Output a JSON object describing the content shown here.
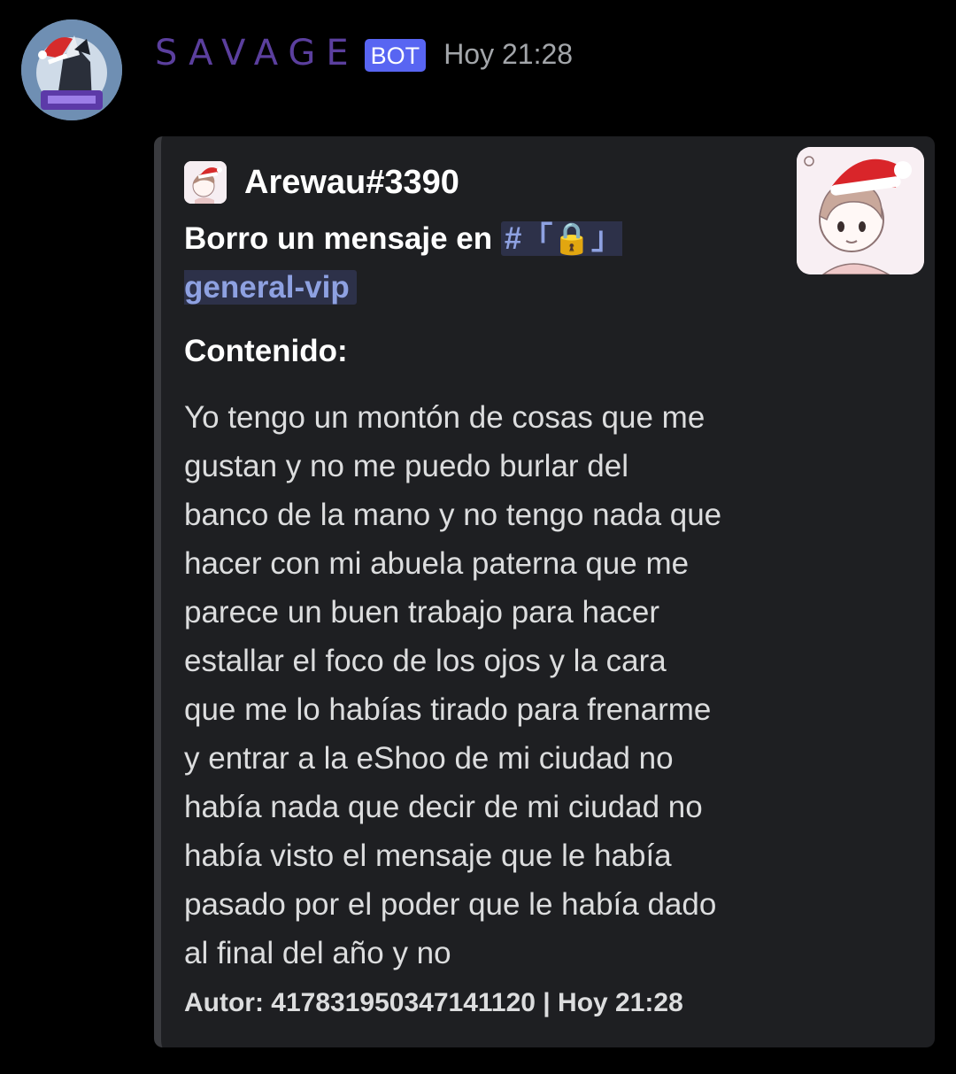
{
  "message": {
    "author": "SAVAGE",
    "badge": "BOT",
    "timestamp": "Hoy 21:28",
    "avatar_icon": "wolf-santa-hat-avatar",
    "colors": {
      "author": "#5b3f9e",
      "badge_bg": "#5865f2",
      "embed_bg": "#1e1f22",
      "embed_border": "#3a3b3f",
      "mention_text": "#8ea1e1",
      "mention_bg": "#2d3149"
    }
  },
  "embed": {
    "author_name": "Arewau#3390",
    "author_icon": "anime-boy-santa-hat-icon",
    "title_prefix": "Borro un mensaje en ",
    "channel": "#「🔒」general-vip",
    "thumbnail_icon": "anime-boy-santa-hat-thumbnail",
    "field_name": "Contenido:",
    "field_value": "Yo tengo un montón de cosas que me\ngustan y no me puedo burlar del\nbanco de la mano y no tengo nada que\nhacer con mi abuela paterna que me\nparece un buen trabajo para hacer\nestallar el foco de los ojos y la cara\nque me lo habías tirado para frenarme\ny entrar a la eShoo de mi ciudad no\nhabía nada que decir de mi ciudad no\nhabía visto el mensaje que le había\npasado por el poder que le había dado\nal final del año y no",
    "footer": "Autor: 417831950347141120 | Hoy 21:28"
  }
}
